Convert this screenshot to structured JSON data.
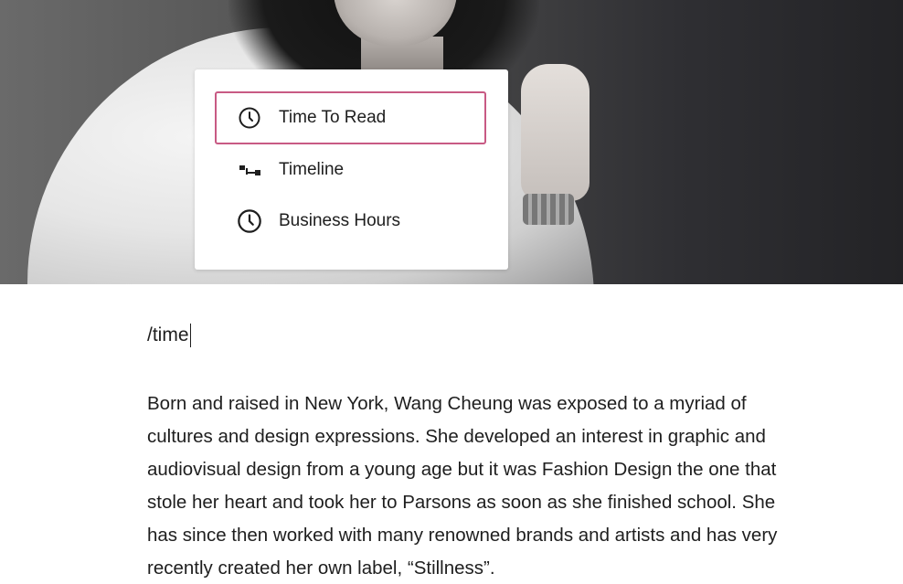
{
  "hero": {
    "icon": "photo-of-woman-in-white-shirt"
  },
  "block_inserter": {
    "items": [
      {
        "label": "Time To Read",
        "icon": "clock-icon",
        "selected": true
      },
      {
        "label": "Timeline",
        "icon": "timeline-icon",
        "selected": false
      },
      {
        "label": "Business Hours",
        "icon": "clock-icon",
        "selected": false
      }
    ],
    "selected_border_color": "#c85a84"
  },
  "editor": {
    "slash_command": "/time",
    "paragraph": "Born and raised in New York, Wang Cheung was exposed to a myriad of\ncultures and design expressions. She developed an interest in graphic and\naudiovisual design from a young age but it was Fashion Design the one that\nstole her heart and took her to Parsons as soon as she finished school. She\nhas since then worked with many renowned brands and artists and has very\nrecently created her own label, “Stillness”."
  }
}
